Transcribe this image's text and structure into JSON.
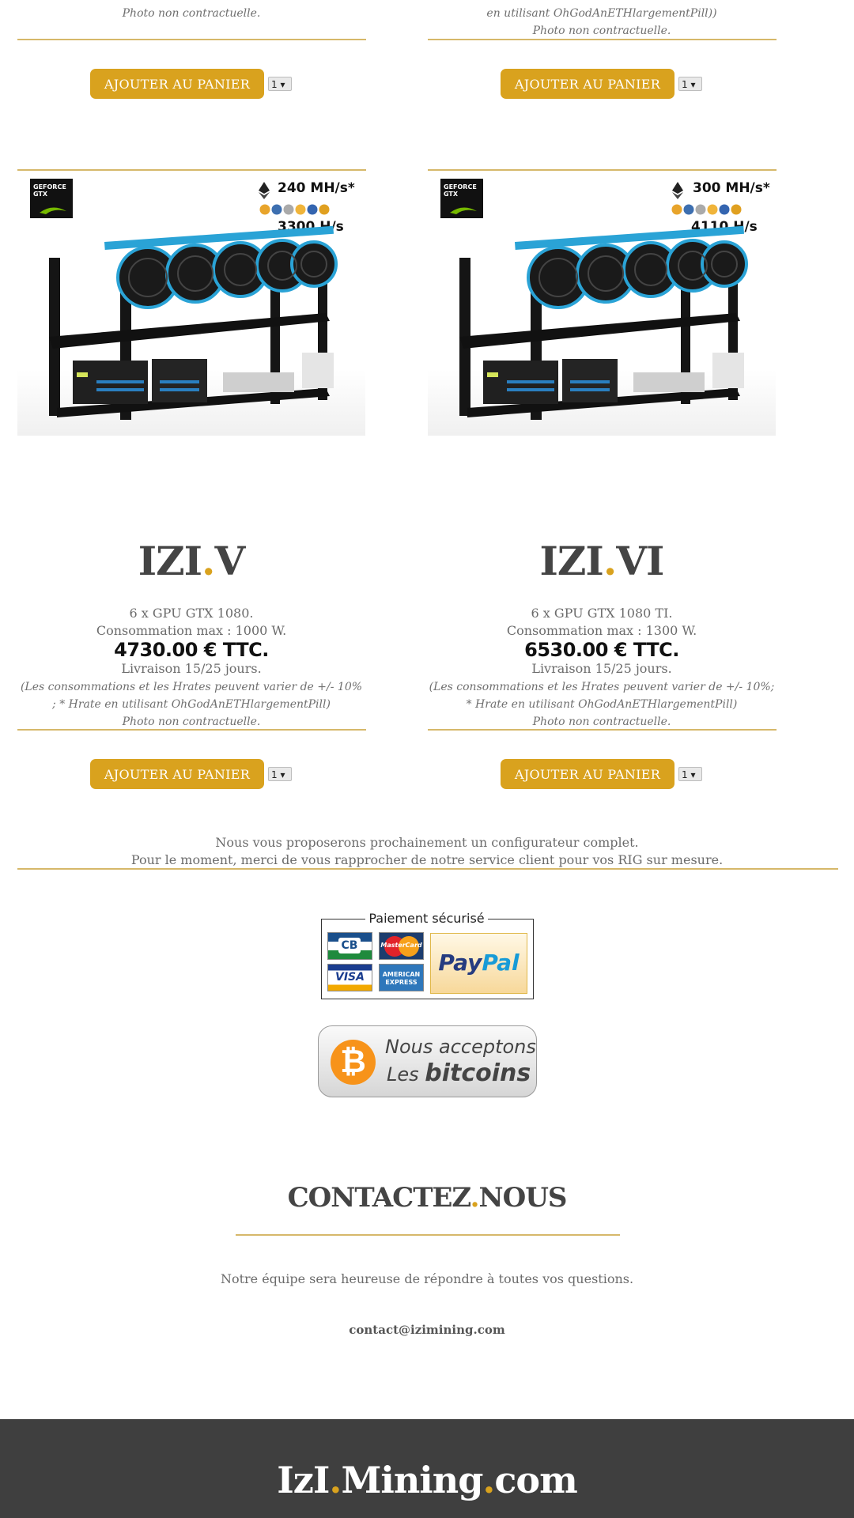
{
  "top": {
    "left_photo_note": "Photo non contractuelle.",
    "right_note_tail": "en utilisant OhGodAnETHlargementPill))",
    "right_photo_note": "Photo non contractuelle."
  },
  "cart": {
    "button_label": "AJOUTER AU PANIER",
    "qty_value": "1 ▾"
  },
  "products": [
    {
      "badge": "GEFORCE GTX",
      "hashrate_eth": "240 MH/s*",
      "hashrate_other": "3300 H/s",
      "title_a": "IZI",
      "title_dot": ".",
      "title_b": "V",
      "gpus": "6 x GPU GTX 1080.",
      "consumption": "Consommation max : 1000 W.",
      "price": "4730.00 € TTC.",
      "delivery": "Livraison 15/25 jours.",
      "note": "(Les consommations et les Hrates peuvent varier de +/- 10% ; * Hrate en utilisant OhGodAnETHlargementPill)",
      "photo_note": "Photo non contractuelle."
    },
    {
      "badge": "GEFORCE GTX",
      "hashrate_eth": "300 MH/s*",
      "hashrate_other": "4110 H/s",
      "title_a": "IZI",
      "title_dot": ".",
      "title_b": "VI",
      "gpus": "6 x GPU GTX 1080 TI.",
      "consumption": "Consommation max : 1300 W.",
      "price": "6530.00 € TTC.",
      "delivery": "Livraison 15/25 jours.",
      "note": "(Les consommations et les Hrates peuvent varier de +/- 10%; * Hrate en utilisant OhGodAnETHlargementPill)",
      "photo_note": "Photo non contractuelle."
    }
  ],
  "configurator": {
    "line1": "Nous vous proposerons prochainement un configurateur complet.",
    "line2": "Pour le moment, merci de vous rapprocher de notre service client pour vos RIG sur mesure."
  },
  "payment": {
    "title": "Paiement sécurisé",
    "cb": "CB",
    "mastercard": "MasterCard",
    "visa": "VISA",
    "amex": "AMERICAN EXPRESS",
    "paypal_a": "Pay",
    "paypal_b": "Pal"
  },
  "bitcoin": {
    "line1": "Nous acceptons",
    "line2a": "Les ",
    "line2b": "bitcoins"
  },
  "contact": {
    "title_a": "CONTACTEZ",
    "title_dot": ".",
    "title_b": "NOUS",
    "text": "Notre équipe sera heureuse de répondre à toutes vos questions.",
    "email": "contact@izimining.com"
  },
  "footer": {
    "brand_a": "IzI",
    "dot1": ".",
    "brand_b": "Mining",
    "dot2": ".",
    "brand_c": "com"
  },
  "colors": {
    "gold": "#d9a21e",
    "footer_bg": "#3f3f3f",
    "line": "#d6b86a"
  }
}
